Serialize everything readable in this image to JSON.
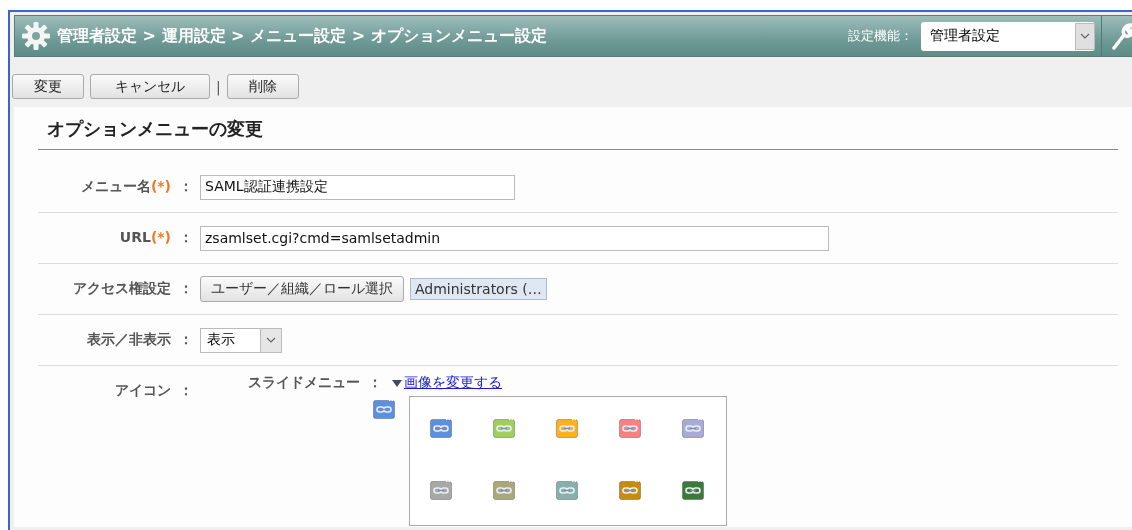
{
  "header": {
    "breadcrumb": "管理者設定 > 運用設定 > メニュー設定 > オプションメニュー設定",
    "function_label": "設定機能：",
    "function_select": "管理者設定"
  },
  "toolbar": [
    {
      "kind": "button",
      "label": "変更"
    },
    {
      "kind": "button",
      "label": "キャンセル"
    },
    {
      "kind": "separator",
      "label": "|"
    },
    {
      "kind": "button",
      "label": "削除"
    }
  ],
  "form": {
    "title": "オプションメニューの変更",
    "rows": [
      {
        "kind": "text",
        "label": "メニュー名",
        "required_mark": "(*)",
        "colon": "：",
        "value": "SAML認証連携設定"
      },
      {
        "kind": "text",
        "label": "URL",
        "required_mark": "(*)",
        "colon": "：",
        "value": "zsamlset.cgi?cmd=samlsetadmin"
      },
      {
        "kind": "access",
        "label": "アクセス権設定",
        "colon": "：",
        "button": "ユーザー／組織／ロール選択",
        "tag": "Administrators (…"
      },
      {
        "kind": "select",
        "label": "表示／非表示",
        "colon": "：",
        "value": "表示"
      },
      {
        "kind": "icon",
        "label": "アイコン",
        "colon": "：",
        "sub_label": "スライドメニュー",
        "sub_colon": "：",
        "link": "画像を変更する",
        "current_icon": {
          "color": "#5b8fe0"
        },
        "choices": [
          {
            "color": "#5b8fe0"
          },
          {
            "color": "#9fcf5a"
          },
          {
            "color": "#ffb020"
          },
          {
            "color": "#f98080"
          },
          {
            "color": "#aaaad8"
          },
          {
            "color": "#a8a8a8"
          },
          {
            "color": "#a8a878"
          },
          {
            "color": "#88b0aa"
          },
          {
            "color": "#c88a10"
          },
          {
            "color": "#3d7a3a"
          }
        ]
      }
    ]
  }
}
